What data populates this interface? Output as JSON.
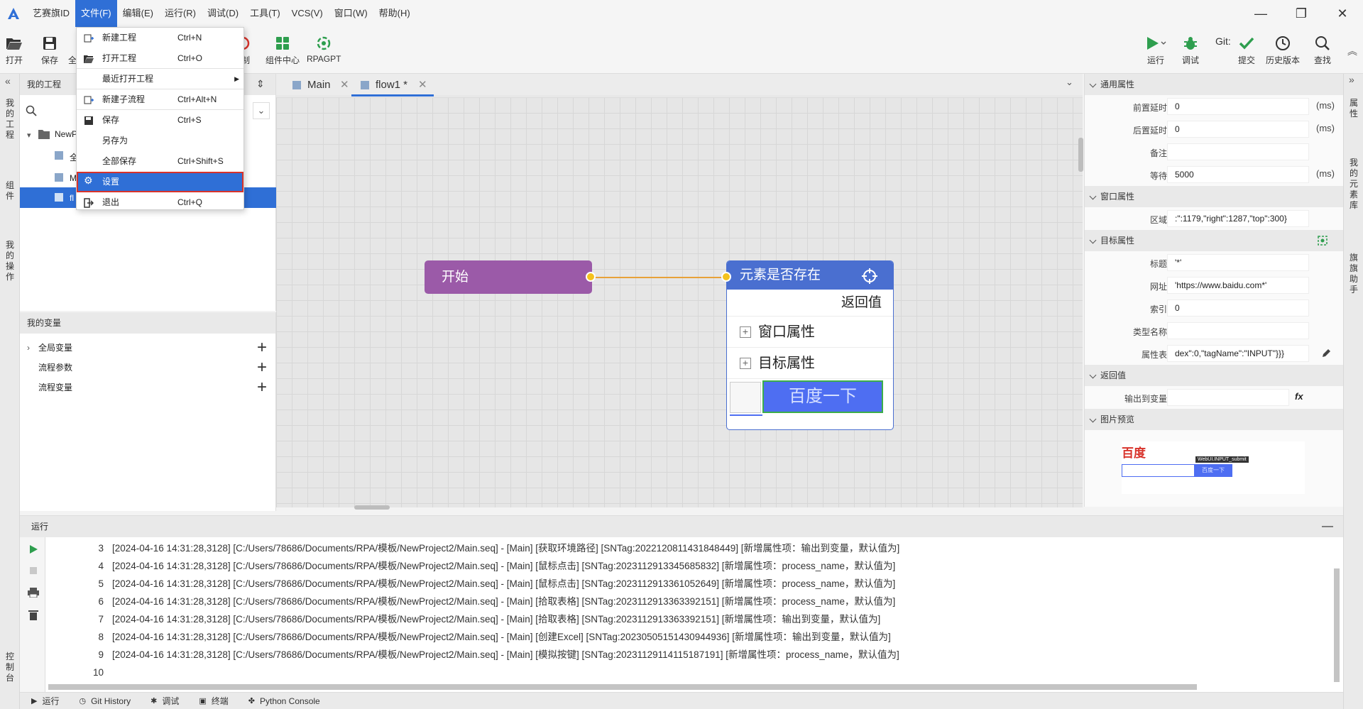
{
  "app": {
    "title": "艺赛旗ID"
  },
  "menubar": {
    "items": [
      "文件(F)",
      "编辑(E)",
      "运行(R)",
      "调试(D)",
      "工具(T)",
      "VCS(V)",
      "窗口(W)",
      "帮助(H)"
    ],
    "window_controls": {
      "minimize": "—",
      "maximize": "❐",
      "close": "✕"
    }
  },
  "toolbar": {
    "open": "打开",
    "save": "保存",
    "save_all_partial": "全",
    "record_partial": "制",
    "component_center": "组件中心",
    "rpagpt": "RPAGPT",
    "run": "运行",
    "debug": "调试",
    "git_label": "Git:",
    "commit": "提交",
    "history": "历史版本",
    "search": "查找"
  },
  "file_menu": {
    "items": [
      {
        "label": "新建工程",
        "shortcut": "Ctrl+N"
      },
      {
        "label": "打开工程",
        "shortcut": "Ctrl+O"
      },
      {
        "label": "最近打开工程",
        "shortcut": ""
      },
      {
        "label": "新建子流程",
        "shortcut": "Ctrl+Alt+N"
      },
      {
        "label": "保存",
        "shortcut": "Ctrl+S"
      },
      {
        "label": "另存为",
        "shortcut": ""
      },
      {
        "label": "全部保存",
        "shortcut": "Ctrl+Shift+S"
      },
      {
        "label": "设置",
        "shortcut": ""
      },
      {
        "label": "退出",
        "shortcut": "Ctrl+Q"
      }
    ]
  },
  "left_rail": {
    "my_project": "我的工程",
    "components": "组件",
    "my_operations": "我的操作",
    "console": "控制台"
  },
  "project_panel": {
    "title": "我的工程",
    "tree": [
      {
        "label": "NewP"
      },
      {
        "label": "全"
      },
      {
        "label": "M"
      },
      {
        "label": "fl"
      }
    ]
  },
  "variables_panel": {
    "title": "我的变量",
    "items": [
      "全局变量",
      "流程参数",
      "流程变量"
    ]
  },
  "editor": {
    "tabs": [
      {
        "label": "Main",
        "close": "✕"
      },
      {
        "label": "flow1 *",
        "close": "✕"
      }
    ],
    "nodes": {
      "start": "开始",
      "element": {
        "title": "元素是否存在",
        "return_value": "返回值",
        "rows": [
          "窗口属性",
          "目标属性"
        ],
        "preview_text": "百度一下"
      }
    }
  },
  "properties": {
    "sections": {
      "general": "通用属性",
      "window": "窗口属性",
      "target": "目标属性",
      "return": "返回值",
      "image": "图片预览"
    },
    "general": [
      {
        "label": "前置延时",
        "value": "0",
        "unit": "(ms)"
      },
      {
        "label": "后置延时",
        "value": "0",
        "unit": "(ms)"
      },
      {
        "label": "备注",
        "value": "",
        "unit": ""
      },
      {
        "label": "等待",
        "value": "5000",
        "unit": "(ms)"
      }
    ],
    "window": [
      {
        "label": "区域",
        "value": ":\":1179,\"right\":1287,\"top\":300}"
      }
    ],
    "target": [
      {
        "label": "标题",
        "value": "'*'"
      },
      {
        "label": "网址",
        "value": "'https://www.baidu.com*'"
      },
      {
        "label": "索引",
        "value": "0"
      },
      {
        "label": "类型名称",
        "value": ""
      },
      {
        "label": "属性表",
        "value": "dex\":0,\"tagName\":\"INPUT\"}}}"
      }
    ],
    "return": [
      {
        "label": "输出到变量",
        "value": ""
      }
    ],
    "image_preview": {
      "logo": "百度",
      "tooltip": "WebUI.INPUT_submit",
      "button": "百度一下"
    }
  },
  "right_rail": {
    "properties": "属性",
    "my_elements": "我的元素库",
    "flag_assistant": "旗旗助手"
  },
  "console": {
    "title": "运行",
    "lines": [
      {
        "n": "3",
        "text": "[2024-04-16 14:31:28,3128] [C:/Users/78686/Documents/RPA/模板/NewProject2/Main.seq] - [Main] [获取环境路径] [SNTag:2022120811431848449] [新增属性项：输出到变量，默认值为]"
      },
      {
        "n": "4",
        "text": "[2024-04-16 14:31:28,3128] [C:/Users/78686/Documents/RPA/模板/NewProject2/Main.seq] - [Main] [鼠标点击] [SNTag:2023112913345685832] [新增属性项：process_name，默认值为]"
      },
      {
        "n": "5",
        "text": "[2024-04-16 14:31:28,3128] [C:/Users/78686/Documents/RPA/模板/NewProject2/Main.seq] - [Main] [鼠标点击] [SNTag:2023112913361052649] [新增属性项：process_name，默认值为]"
      },
      {
        "n": "6",
        "text": "[2024-04-16 14:31:28,3128] [C:/Users/78686/Documents/RPA/模板/NewProject2/Main.seq] - [Main] [拾取表格] [SNTag:2023112913363392151] [新增属性项：process_name，默认值为]"
      },
      {
        "n": "7",
        "text": "[2024-04-16 14:31:28,3128] [C:/Users/78686/Documents/RPA/模板/NewProject2/Main.seq] - [Main] [拾取表格] [SNTag:2023112913363392151] [新增属性项：输出到变量，默认值为]"
      },
      {
        "n": "8",
        "text": "[2024-04-16 14:31:28,3128] [C:/Users/78686/Documents/RPA/模板/NewProject2/Main.seq] - [Main] [创建Excel] [SNTag:2023050515143094493​6] [新增属性项：输出到变量，默认值为]"
      },
      {
        "n": "9",
        "text": "[2024-04-16 14:31:28,3128] [C:/Users/78686/Documents/RPA/模板/NewProject2/Main.seq] - [Main] [模拟按键] [SNTag:2023112911411518719​1] [新增属性项：process_name，默认值为]"
      },
      {
        "n": "10",
        "text": ""
      }
    ]
  },
  "bottom_bar": {
    "items": [
      "运行",
      "Git History",
      "调试",
      "终端",
      "Python Console"
    ]
  },
  "colors": {
    "accent": "#2f6fd6",
    "start_node": "#9b5aa8",
    "element_node": "#4a6fd0",
    "edge": "#e8a23a",
    "port": "#f4c21d",
    "highlight": "#d8332b"
  }
}
